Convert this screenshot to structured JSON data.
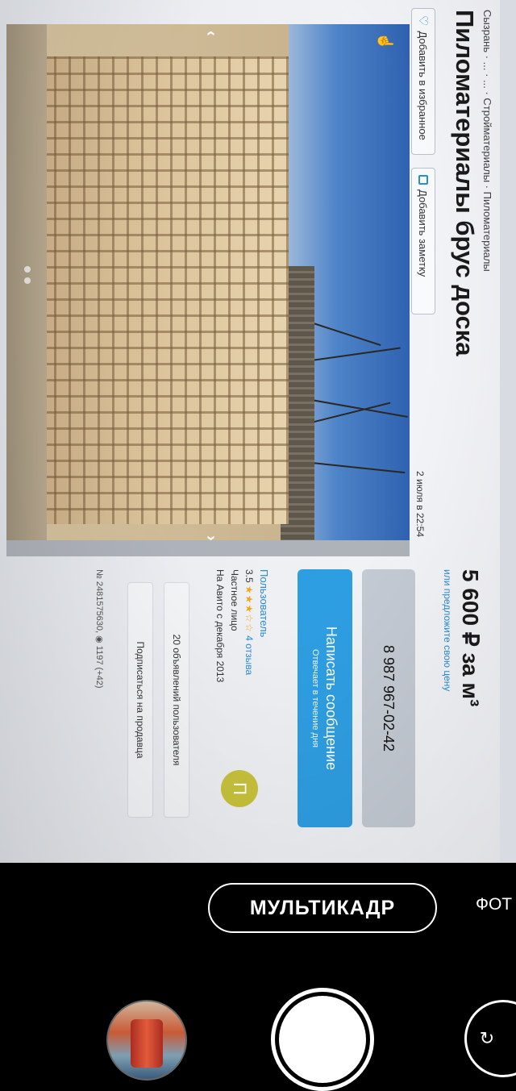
{
  "listing": {
    "breadcrumb": "Сызрань · ... · ... · Стройматериалы · Пиломатериалы",
    "title": "Пиломатериалы брус доска",
    "favorite_label": "Добавить в избранное",
    "note_label": "Добавить заметку",
    "date": "2 июля в 22:54",
    "price": "5 600 ₽ за м³",
    "price_note": "или предложите свою цену",
    "phone": "8 987 967-02-42",
    "write_title": "Написать сообщение",
    "write_sub": "Отвечает в течение дня",
    "seller_role": "Пользователь",
    "rating": "3.5",
    "stars": "★★★☆☆",
    "reviews": "4 отзыва",
    "seller_type": "Частное лицо",
    "seller_since": "На Авито с декабря 2013",
    "avatar_letter": "П",
    "ads_label": "20 объявлений пользователя",
    "subscribe_label": "Подписаться на продавца",
    "ad_meta": "№ 2481575630, ◉ 1197 (+42)"
  },
  "camera": {
    "mode": "МУЛЬТИКАДР",
    "next_mode": "ФОТ"
  },
  "colors": {
    "accent": "#2e9ee2",
    "phone_button": "#c4cad3",
    "avatar": "#c8c23b",
    "camera_bg": "#000000"
  },
  "icons": [
    "heart-icon",
    "note-icon",
    "chevron-left-icon",
    "chevron-right-icon",
    "views-icon",
    "shutter-icon",
    "switch-camera-icon"
  ]
}
